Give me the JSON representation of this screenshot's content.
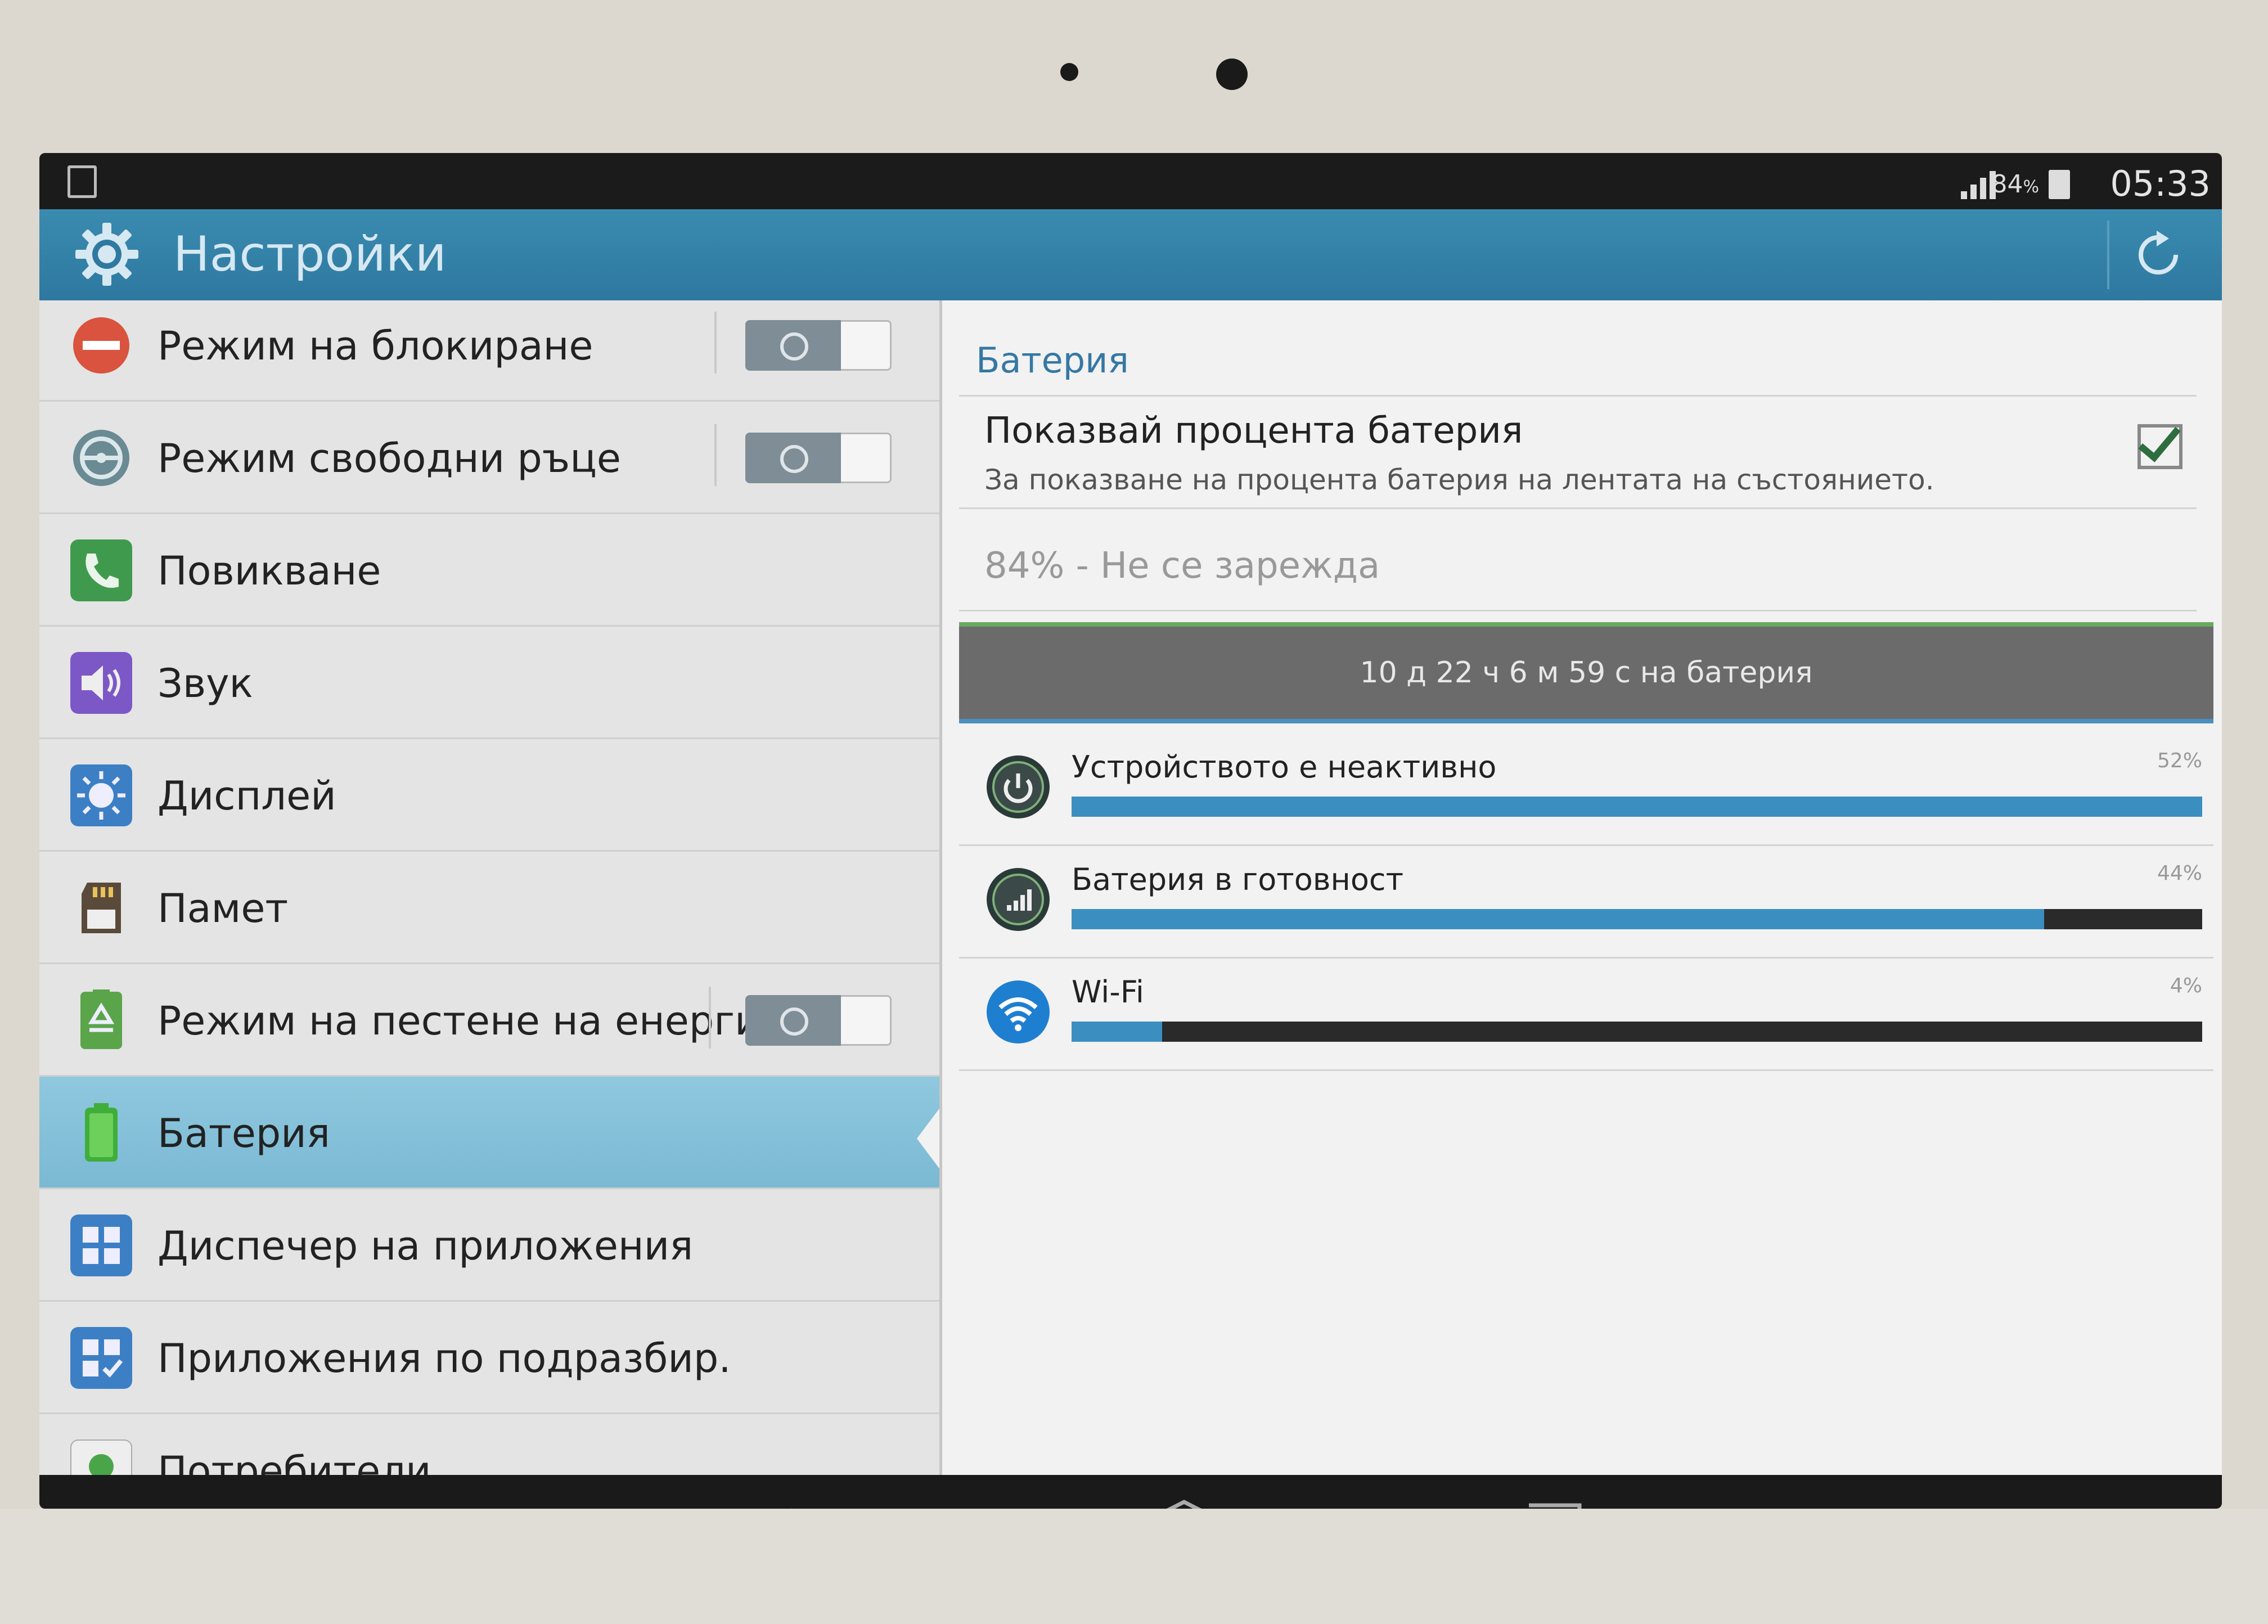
{
  "statusbar": {
    "battery_percent": "84",
    "percent_sign": "%",
    "time": "05:33"
  },
  "actionbar": {
    "title": "Настройки"
  },
  "settings_list": [
    {
      "label": "Режим на блокиране",
      "icon": "block-icon",
      "toggle": "off"
    },
    {
      "label": "Режим свободни ръце",
      "icon": "steering-wheel-icon",
      "toggle": "off"
    },
    {
      "label": "Повикване",
      "icon": "phone-icon"
    },
    {
      "label": "Звук",
      "icon": "speaker-icon"
    },
    {
      "label": "Дисплей",
      "icon": "brightness-icon"
    },
    {
      "label": "Памет",
      "icon": "sd-card-icon"
    },
    {
      "label": "Режим на пестене на енергия",
      "icon": "recycle-icon",
      "toggle": "off"
    },
    {
      "label": "Батерия",
      "icon": "battery-icon",
      "selected": true
    },
    {
      "label": "Диспечер на приложения",
      "icon": "grid-icon"
    },
    {
      "label": "Приложения по подразбир.",
      "icon": "grid-check-icon"
    },
    {
      "label": "Потребители",
      "icon": "user-icon"
    }
  ],
  "battery": {
    "section_title": "Батерия",
    "show_percent_title": "Показвай процента батерия",
    "show_percent_sub": "За показване на процента батерия на лентата на състоянието.",
    "show_percent_checked": true,
    "status": "84% - Не се зарежда",
    "graph_text": "10 д 22 ч 6 м 59 с на батерия",
    "usage": [
      {
        "name": "Устройството е неактивно",
        "percent_label": "52%",
        "fraction": 1.0,
        "icon": "power-icon"
      },
      {
        "name": "Батерия в готовност",
        "percent_label": "44%",
        "fraction": 0.86,
        "icon": "cell-signal-icon"
      },
      {
        "name": "Wi-Fi",
        "percent_label": "4%",
        "fraction": 0.08,
        "icon": "wifi-icon"
      }
    ]
  },
  "colors": {
    "accent": "#3578a3",
    "actionbar": "#3a8bb0",
    "selected": "#8fc8df",
    "bar_fill": "#3b8fc0"
  }
}
